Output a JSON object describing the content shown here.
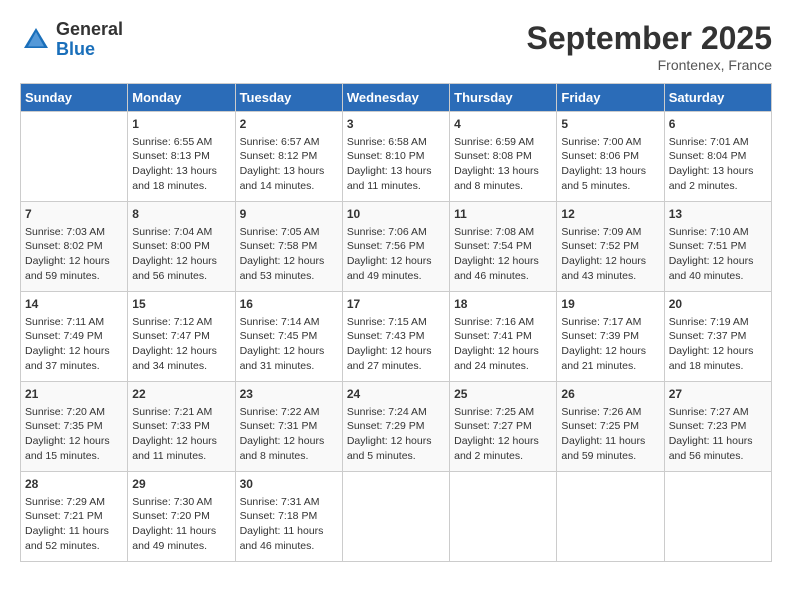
{
  "header": {
    "logo_general": "General",
    "logo_blue": "Blue",
    "month_title": "September 2025",
    "location": "Frontenex, France"
  },
  "weekdays": [
    "Sunday",
    "Monday",
    "Tuesday",
    "Wednesday",
    "Thursday",
    "Friday",
    "Saturday"
  ],
  "weeks": [
    [
      {
        "day": "",
        "info": ""
      },
      {
        "day": "1",
        "info": "Sunrise: 6:55 AM\nSunset: 8:13 PM\nDaylight: 13 hours\nand 18 minutes."
      },
      {
        "day": "2",
        "info": "Sunrise: 6:57 AM\nSunset: 8:12 PM\nDaylight: 13 hours\nand 14 minutes."
      },
      {
        "day": "3",
        "info": "Sunrise: 6:58 AM\nSunset: 8:10 PM\nDaylight: 13 hours\nand 11 minutes."
      },
      {
        "day": "4",
        "info": "Sunrise: 6:59 AM\nSunset: 8:08 PM\nDaylight: 13 hours\nand 8 minutes."
      },
      {
        "day": "5",
        "info": "Sunrise: 7:00 AM\nSunset: 8:06 PM\nDaylight: 13 hours\nand 5 minutes."
      },
      {
        "day": "6",
        "info": "Sunrise: 7:01 AM\nSunset: 8:04 PM\nDaylight: 13 hours\nand 2 minutes."
      }
    ],
    [
      {
        "day": "7",
        "info": "Sunrise: 7:03 AM\nSunset: 8:02 PM\nDaylight: 12 hours\nand 59 minutes."
      },
      {
        "day": "8",
        "info": "Sunrise: 7:04 AM\nSunset: 8:00 PM\nDaylight: 12 hours\nand 56 minutes."
      },
      {
        "day": "9",
        "info": "Sunrise: 7:05 AM\nSunset: 7:58 PM\nDaylight: 12 hours\nand 53 minutes."
      },
      {
        "day": "10",
        "info": "Sunrise: 7:06 AM\nSunset: 7:56 PM\nDaylight: 12 hours\nand 49 minutes."
      },
      {
        "day": "11",
        "info": "Sunrise: 7:08 AM\nSunset: 7:54 PM\nDaylight: 12 hours\nand 46 minutes."
      },
      {
        "day": "12",
        "info": "Sunrise: 7:09 AM\nSunset: 7:52 PM\nDaylight: 12 hours\nand 43 minutes."
      },
      {
        "day": "13",
        "info": "Sunrise: 7:10 AM\nSunset: 7:51 PM\nDaylight: 12 hours\nand 40 minutes."
      }
    ],
    [
      {
        "day": "14",
        "info": "Sunrise: 7:11 AM\nSunset: 7:49 PM\nDaylight: 12 hours\nand 37 minutes."
      },
      {
        "day": "15",
        "info": "Sunrise: 7:12 AM\nSunset: 7:47 PM\nDaylight: 12 hours\nand 34 minutes."
      },
      {
        "day": "16",
        "info": "Sunrise: 7:14 AM\nSunset: 7:45 PM\nDaylight: 12 hours\nand 31 minutes."
      },
      {
        "day": "17",
        "info": "Sunrise: 7:15 AM\nSunset: 7:43 PM\nDaylight: 12 hours\nand 27 minutes."
      },
      {
        "day": "18",
        "info": "Sunrise: 7:16 AM\nSunset: 7:41 PM\nDaylight: 12 hours\nand 24 minutes."
      },
      {
        "day": "19",
        "info": "Sunrise: 7:17 AM\nSunset: 7:39 PM\nDaylight: 12 hours\nand 21 minutes."
      },
      {
        "day": "20",
        "info": "Sunrise: 7:19 AM\nSunset: 7:37 PM\nDaylight: 12 hours\nand 18 minutes."
      }
    ],
    [
      {
        "day": "21",
        "info": "Sunrise: 7:20 AM\nSunset: 7:35 PM\nDaylight: 12 hours\nand 15 minutes."
      },
      {
        "day": "22",
        "info": "Sunrise: 7:21 AM\nSunset: 7:33 PM\nDaylight: 12 hours\nand 11 minutes."
      },
      {
        "day": "23",
        "info": "Sunrise: 7:22 AM\nSunset: 7:31 PM\nDaylight: 12 hours\nand 8 minutes."
      },
      {
        "day": "24",
        "info": "Sunrise: 7:24 AM\nSunset: 7:29 PM\nDaylight: 12 hours\nand 5 minutes."
      },
      {
        "day": "25",
        "info": "Sunrise: 7:25 AM\nSunset: 7:27 PM\nDaylight: 12 hours\nand 2 minutes."
      },
      {
        "day": "26",
        "info": "Sunrise: 7:26 AM\nSunset: 7:25 PM\nDaylight: 11 hours\nand 59 minutes."
      },
      {
        "day": "27",
        "info": "Sunrise: 7:27 AM\nSunset: 7:23 PM\nDaylight: 11 hours\nand 56 minutes."
      }
    ],
    [
      {
        "day": "28",
        "info": "Sunrise: 7:29 AM\nSunset: 7:21 PM\nDaylight: 11 hours\nand 52 minutes."
      },
      {
        "day": "29",
        "info": "Sunrise: 7:30 AM\nSunset: 7:20 PM\nDaylight: 11 hours\nand 49 minutes."
      },
      {
        "day": "30",
        "info": "Sunrise: 7:31 AM\nSunset: 7:18 PM\nDaylight: 11 hours\nand 46 minutes."
      },
      {
        "day": "",
        "info": ""
      },
      {
        "day": "",
        "info": ""
      },
      {
        "day": "",
        "info": ""
      },
      {
        "day": "",
        "info": ""
      }
    ]
  ]
}
